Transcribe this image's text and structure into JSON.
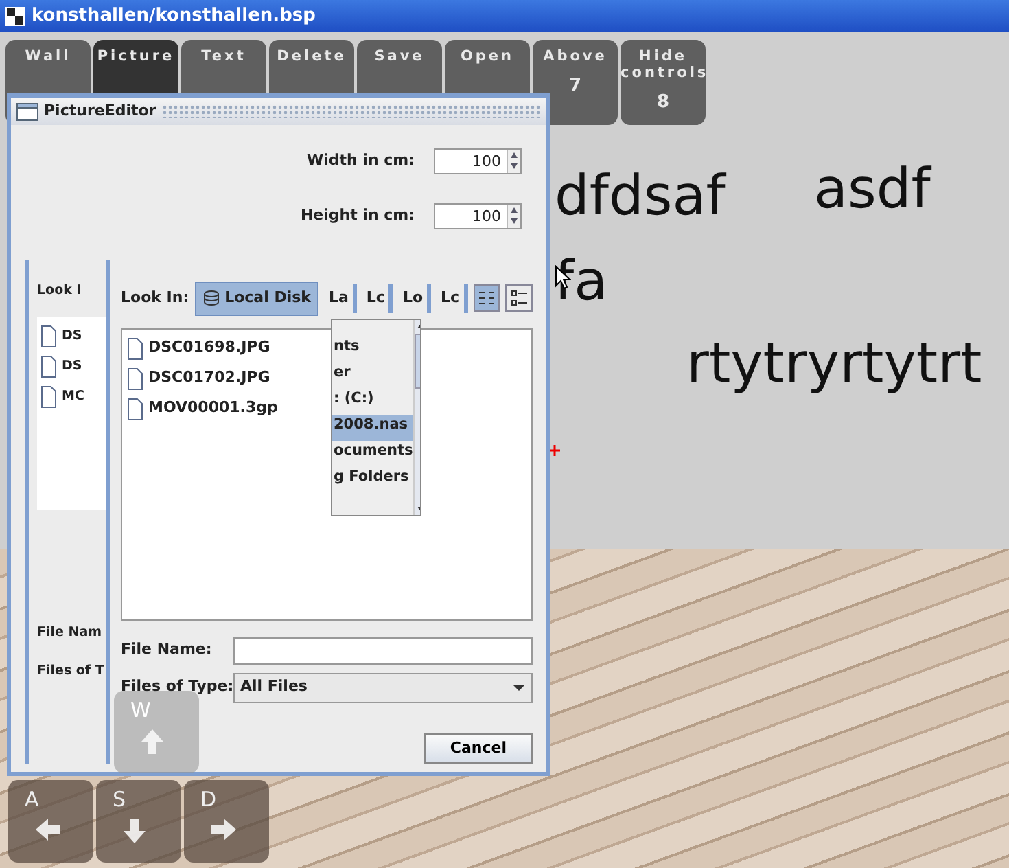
{
  "window": {
    "title": "konsthallen/konsthallen.bsp"
  },
  "toolbar": [
    {
      "label": "Wall",
      "selected": false
    },
    {
      "label": "Picture",
      "selected": true
    },
    {
      "label": "Text",
      "selected": false
    },
    {
      "label": "Delete",
      "selected": false
    },
    {
      "label": "Save",
      "selected": false
    },
    {
      "label": "Open",
      "selected": false
    },
    {
      "label": "Above",
      "number": "7",
      "selected": false
    },
    {
      "label": "Hide controls",
      "number": "8",
      "selected": false
    }
  ],
  "scene_texts": [
    "dfdsaf",
    "asdf",
    "fa",
    "rtytryrtytrt"
  ],
  "dialog": {
    "title": "PictureEditor",
    "width_label": "Width in cm:",
    "width_value": "100",
    "height_label": "Height in cm:",
    "height_value": "100",
    "back_chooser": {
      "look_in_label": "Look I",
      "files": [
        "DS",
        "DS",
        "MC"
      ],
      "file_name_label": "File Nam",
      "files_of_type_label": "Files of T"
    },
    "chooser": {
      "look_in_label": "Look In:",
      "look_in_value": "Local Disk",
      "buttons": [
        "La",
        "Lc",
        "Lo",
        "Lc"
      ],
      "view_modes": [
        {
          "kind": "list",
          "selected": true
        },
        {
          "kind": "details",
          "selected": false
        }
      ],
      "files": [
        "DSC01698.JPG",
        "DSC01702.JPG",
        "MOV00001.3gp"
      ],
      "popup_items": [
        {
          "label": "nts",
          "selected": false
        },
        {
          "label": "er",
          "selected": false
        },
        {
          "label": ": (C:)",
          "selected": false
        },
        {
          "label": "2008.nas",
          "selected": true
        },
        {
          "label": "ocuments",
          "selected": false
        },
        {
          "label": "g Folders",
          "selected": false
        }
      ],
      "file_name_label": "File Name:",
      "files_of_type_label": "Files of Type:",
      "files_of_type_value": "All Files",
      "cancel": "Cancel"
    }
  },
  "movement_keys": [
    {
      "letter": "W",
      "kind": "up",
      "faded": true
    },
    {
      "letter": "A",
      "kind": "left",
      "faded": false
    },
    {
      "letter": "S",
      "kind": "down",
      "faded": false
    },
    {
      "letter": "D",
      "kind": "right",
      "faded": false
    }
  ]
}
